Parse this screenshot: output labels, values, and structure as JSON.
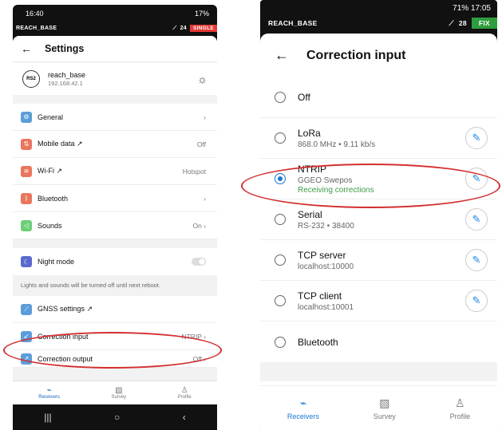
{
  "left": {
    "status_time": "16:40",
    "status_battery": "17%",
    "reach_label": "REACH_BASE",
    "sat_count": "24",
    "solution": "SINGLE",
    "title": "Settings",
    "device": {
      "badge": "RS2",
      "name": "reach_base",
      "ip": "192.168.42.1"
    },
    "rows": [
      {
        "label": "General",
        "value": "›",
        "icon_color": "#5c9dd9"
      },
      {
        "label": "Mobile data ↗",
        "value": "Off",
        "icon_color": "#e9765c"
      },
      {
        "label": "Wi-Fi ↗",
        "value": "Hotspot",
        "icon_color": "#e9765c"
      },
      {
        "label": "Bluetooth",
        "value": "›",
        "icon_color": "#e9765c"
      },
      {
        "label": "Sounds",
        "value": "On ›",
        "icon_color": "#6ccf78"
      }
    ],
    "night_mode": "Night mode",
    "note": "Lights and sounds will be turned off until next reboot.",
    "gnss": "GNSS settings ↗",
    "correction_input": {
      "label": "Correction input",
      "value": "NTRIP ›"
    },
    "correction_output": {
      "label": "Correction output",
      "value": "Off ›"
    },
    "tabs": [
      "Receivers",
      "Survey",
      "Profile"
    ]
  },
  "right": {
    "status": "71% 17:05",
    "reach_label": "REACH_BASE",
    "sat_count": "28",
    "solution": "FIX",
    "title": "Correction input",
    "options": [
      {
        "name": "Off",
        "sub": "",
        "status": "",
        "selected": false,
        "editable": false
      },
      {
        "name": "LoRa",
        "sub": "868.0 MHz • 9.11 kb/s",
        "status": "",
        "selected": false,
        "editable": true
      },
      {
        "name": "NTRIP",
        "sub": "GGEO Swepos",
        "status": "Receiving corrections",
        "selected": true,
        "editable": true
      },
      {
        "name": "Serial",
        "sub": "RS-232 • 38400",
        "status": "",
        "selected": false,
        "editable": true
      },
      {
        "name": "TCP server",
        "sub": "localhost:10000",
        "status": "",
        "selected": false,
        "editable": true
      },
      {
        "name": "TCP client",
        "sub": "localhost:10001",
        "status": "",
        "selected": false,
        "editable": true
      },
      {
        "name": "Bluetooth",
        "sub": "",
        "status": "",
        "selected": false,
        "editable": false
      }
    ],
    "tabs": [
      "Receivers",
      "Survey",
      "Profile"
    ]
  },
  "colors": {
    "accent": "#1976d2",
    "fix": "#2e9d3e",
    "single": "#e53935",
    "annotation": "#d32f2f"
  }
}
